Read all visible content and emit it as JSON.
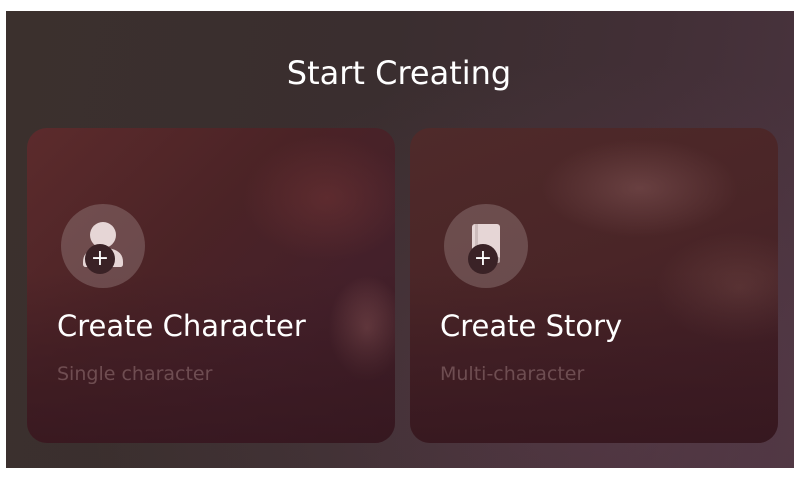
{
  "header": {
    "title": "Start Creating"
  },
  "cards": [
    {
      "title": "Create Character",
      "subtitle": "Single character",
      "icon": "person-icon",
      "badge": "+"
    },
    {
      "title": "Create Story",
      "subtitle": "Multi-character",
      "icon": "book-icon",
      "badge": "+"
    }
  ],
  "colors": {
    "title_text": "#ffffff",
    "subtitle_text": "#7a5a5c",
    "icon_circle": "#7a6668",
    "badge_bg": "#3a2226"
  }
}
